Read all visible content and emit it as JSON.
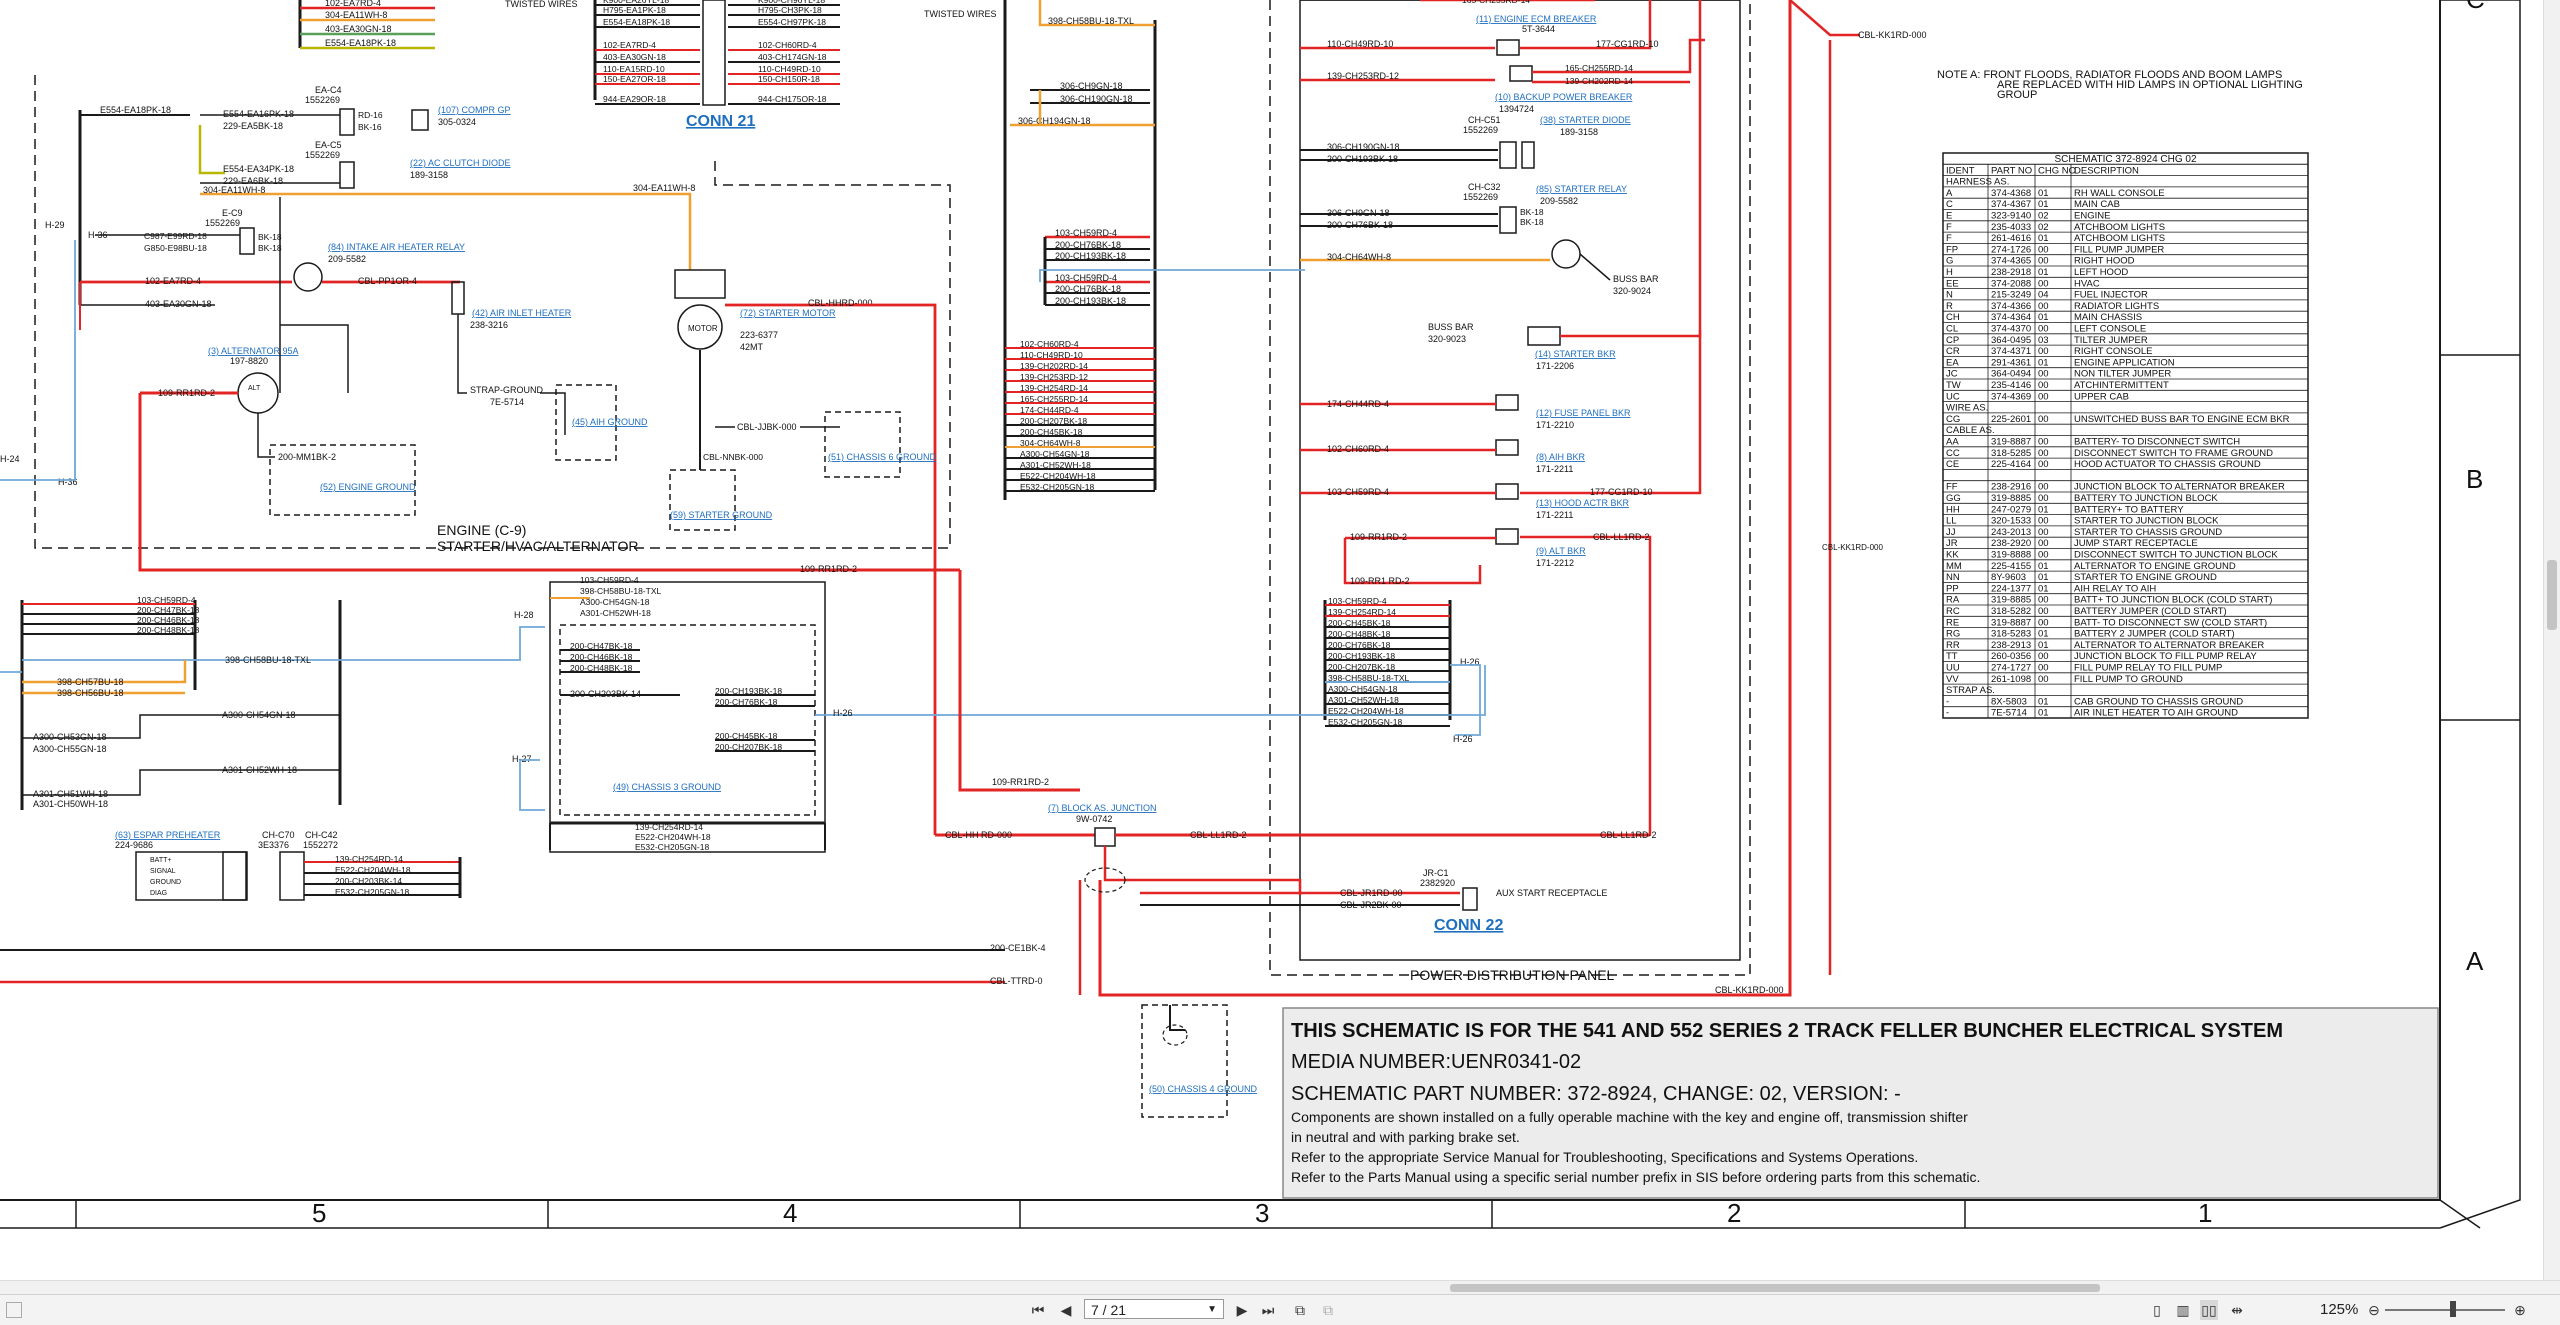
{
  "zones": [
    "5",
    "4",
    "3",
    "2",
    "1"
  ],
  "rows": [
    "C",
    "B",
    "A"
  ],
  "conn21": "CONN 21",
  "conn22": "CONN 22",
  "engine_box_label_1": "ENGINE (C-9)",
  "engine_box_label_2": "STARTER/HVAC/ALTERNATOR",
  "pdp_label": "POWER DISTRIBUTION PANEL",
  "twisted_wires": "TWISTED WIRES",
  "note_a": [
    "NOTE A:   FRONT FLOODS, RADIATOR FLOODS AND BOOM LAMPS",
    "ARE REPLACED WITH HID LAMPS IN OPTIONAL LIGHTING",
    "GROUP"
  ],
  "table": {
    "title": "SCHEMATIC 372-8924 CHG 02",
    "headers": [
      "IDENT",
      "PART NO",
      "CHG NO",
      "DESCRIPTION"
    ],
    "rows": [
      [
        "HARNESS AS.",
        "",
        "",
        ""
      ],
      [
        "A",
        "374-4368",
        "01",
        "RH WALL CONSOLE"
      ],
      [
        "C",
        "374-4367",
        "01",
        "MAIN CAB"
      ],
      [
        "E",
        "323-9140",
        "02",
        "ENGINE"
      ],
      [
        "F",
        "235-4033",
        "02",
        "ATCHBOOM LIGHTS"
      ],
      [
        "F",
        "261-4616",
        "01",
        "ATCHBOOM LIGHTS"
      ],
      [
        "FP",
        "274-1726",
        "00",
        "FILL PUMP JUMPER"
      ],
      [
        "G",
        "374-4365",
        "00",
        "RIGHT HOOD"
      ],
      [
        "H",
        "238-2918",
        "01",
        "LEFT HOOD"
      ],
      [
        "EE",
        "374-2088",
        "00",
        "HVAC"
      ],
      [
        "N",
        "215-3249",
        "04",
        "FUEL INJECTOR"
      ],
      [
        "R",
        "374-4366",
        "00",
        "RADIATOR LIGHTS"
      ],
      [
        "CH",
        "374-4364",
        "01",
        "MAIN CHASSIS"
      ],
      [
        "CL",
        "374-4370",
        "00",
        "LEFT CONSOLE"
      ],
      [
        "CP",
        "364-0495",
        "03",
        "TILTER JUMPER"
      ],
      [
        "CR",
        "374-4371",
        "00",
        "RIGHT CONSOLE"
      ],
      [
        "EA",
        "291-4361",
        "01",
        "ENGINE APPLICATION"
      ],
      [
        "JC",
        "364-0494",
        "00",
        "NON TILTER JUMPER"
      ],
      [
        "TW",
        "235-4146",
        "00",
        "ATCHINTERMITTENT"
      ],
      [
        "UC",
        "374-4369",
        "00",
        "UPPER CAB"
      ],
      [
        "WIRE AS.",
        "",
        "",
        ""
      ],
      [
        "CG",
        "225-2601",
        "00",
        "UNSWITCHED BUSS BAR TO ENGINE ECM BKR"
      ],
      [
        "CABLE AS.",
        "",
        "",
        ""
      ],
      [
        "AA",
        "319-8887",
        "00",
        "BATTERY- TO DISCONNECT SWITCH"
      ],
      [
        "CC",
        "318-5285",
        "00",
        "DISCONNECT SWITCH TO FRAME GROUND"
      ],
      [
        "CE",
        "225-4164",
        "00",
        "HOOD ACTUATOR TO CHASSIS GROUND"
      ],
      [
        "",
        "",
        "",
        ""
      ],
      [
        "FF",
        "238-2916",
        "00",
        "JUNCTION BLOCK TO ALTERNATOR BREAKER"
      ],
      [
        "GG",
        "319-8885",
        "00",
        "BATTERY TO JUNCTION BLOCK"
      ],
      [
        "HH",
        "247-0279",
        "01",
        "BATTERY+ TO BATTERY"
      ],
      [
        "LL",
        "320-1533",
        "00",
        "STARTER TO JUNCTION BLOCK"
      ],
      [
        "JJ",
        "243-2013",
        "00",
        "STARTER TO CHASSIS GROUND"
      ],
      [
        "JR",
        "238-2920",
        "00",
        "JUMP START RECEPTACLE"
      ],
      [
        "KK",
        "319-8888",
        "00",
        "DISCONNECT SWITCH TO JUNCTION BLOCK"
      ],
      [
        "MM",
        "225-4155",
        "01",
        "ALTERNATOR TO ENGINE GROUND"
      ],
      [
        "NN",
        "8Y-9603",
        "01",
        "STARTER TO ENGINE GROUND"
      ],
      [
        "PP",
        "224-1377",
        "01",
        "AIH RELAY TO AIH"
      ],
      [
        "RA",
        "319-8885",
        "00",
        "BATT+ TO JUNCTION BLOCK (COLD START)"
      ],
      [
        "RC",
        "318-5282",
        "00",
        "BATTERY JUMPER (COLD START)"
      ],
      [
        "RE",
        "319-8887",
        "00",
        "BATT- TO DISCONNECT SW (COLD START)"
      ],
      [
        "RG",
        "318-5283",
        "01",
        "BATTERY 2 JUMPER (COLD START)"
      ],
      [
        "RR",
        "238-2913",
        "01",
        "ALTERNATOR TO ALTERNATOR BREAKER"
      ],
      [
        "TT",
        "260-0356",
        "00",
        "JUNCTION BLOCK TO FILL PUMP RELAY"
      ],
      [
        "UU",
        "274-1727",
        "00",
        "FILL PUMP RELAY TO FILL PUMP"
      ],
      [
        "VV",
        "261-1098",
        "00",
        "FILL PUMP TO GROUND"
      ],
      [
        "STRAP AS.",
        "",
        "",
        ""
      ],
      [
        "-",
        "8X-5803",
        "01",
        "CAB GROUND TO CHASSIS GROUND"
      ],
      [
        "-",
        "7E-5714",
        "01",
        "AIR INLET HEATER TO AIH GROUND"
      ]
    ]
  },
  "title_block": {
    "line1": "THIS SCHEMATIC IS FOR THE 541 AND 552 SERIES 2 TRACK FELLER BUNCHER ELECTRICAL SYSTEM",
    "line2": "MEDIA NUMBER:UENR0341-02",
    "line3": "SCHEMATIC PART NUMBER: 372-8924, CHANGE: 02, VERSION: -",
    "line4": "Components are shown installed on a fully operable machine with the key and engine off, transmission shifter",
    "line5": "in neutral and with parking brake set.",
    "line6": "Refer to the appropriate Service Manual for Troubleshooting, Specifications and Systems Operations.",
    "line7": "Refer to the Parts Manual using a specific serial number prefix in SIS before ordering parts from this schematic."
  },
  "components": {
    "c107": "(107) COMPR GP",
    "c107p": "305-0324",
    "c22": "(22) AC CLUTCH DIODE",
    "c22p": "189-3158",
    "ea_c4": "EA-C4",
    "ea_c4p": "1552269",
    "ea_c5": "EA-C5",
    "ea_c5p": "1552269",
    "e_c9": "E-C9",
    "e_c9p": "1552269",
    "c84": "(84) INTAKE AIR HEATER RELAY",
    "c84p": "209-5582",
    "c42": "(42) AIR INLET HEATER",
    "c42p": "238-3216",
    "c3": "(3) ALTERNATOR 95A",
    "c3p": "197-8820",
    "c72": "(72) STARTER MOTOR",
    "c72p": "223-6377",
    "c72p2": "42MT",
    "c52": "(52) ENGINE GROUND",
    "c45": "(45) AIH GROUND",
    "c51": "(51) CHASSIS 6 GROUND",
    "c59": "(59) STARTER GROUND",
    "strap": "STRAP-GROUND",
    "strapp": "7E-5714",
    "motor": "MOTOR",
    "c11": "(11) ENGINE ECM BREAKER",
    "c11p": "5T-3644",
    "c10": "(10) BACKUP POWER BREAKER",
    "c10p": "1394724",
    "c38": "(38) STARTER DIODE",
    "c38p": "189-3158",
    "ch_c51": "CH-C51",
    "ch_c51p": "1552269",
    "c85": "(85) STARTER RELAY",
    "c85p": "209-5582",
    "ch_c32": "CH-C32",
    "ch_c32p": "1552269",
    "busbar": "BUSS BAR",
    "busbarp": "320-9024",
    "busbar2": "BUSS BAR",
    "busbar2p": "320-9023",
    "c14": "(14) STARTER BKR",
    "c14p": "171-2206",
    "c12": "(12) FUSE PANEL BKR",
    "c12p": "171-2210",
    "c8": "(8) AIH BKR",
    "c8p": "171-2211",
    "c13": "(13) HOOD ACTR BKR",
    "c13p": "171-2211",
    "c9": "(9) ALT BKR",
    "c9p": "171-2212",
    "c7": "(7) BLOCK AS. JUNCTION",
    "c7p": "9W-0742",
    "jr_c1": "JR-C1",
    "jr_c1p": "2382920",
    "aux": "AUX START RECEPTACLE",
    "c49": "(49) CHASSIS 3 GROUND",
    "c50": "(50) CHASSIS 4 GROUND",
    "c63": "(63) ESPAR PREHEATER",
    "c63p": "224-9686",
    "ch_c70": "CH-C70",
    "ch_c70p": "3E3376",
    "ch_c42": "CH-C42",
    "ch_c42p": "1552272"
  },
  "toolbar": {
    "page_value": "7 / 21",
    "zoom": "125%"
  }
}
